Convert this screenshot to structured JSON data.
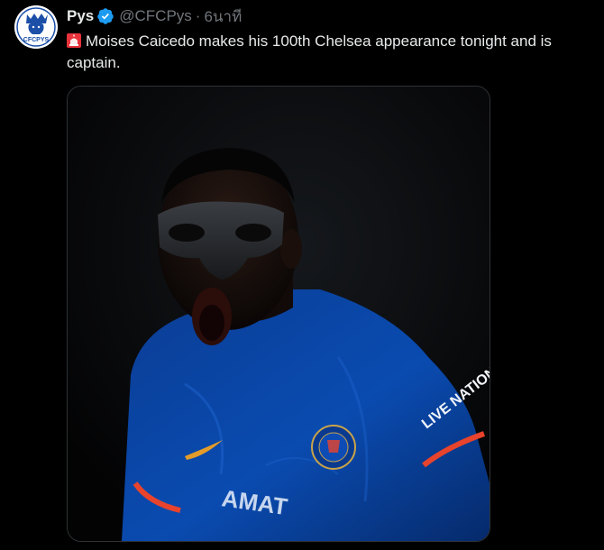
{
  "tweet": {
    "author": {
      "display_name": "Pys",
      "handle": "@CFCPys",
      "verified": true,
      "avatar_text": "CFCPYS"
    },
    "separator": "·",
    "timestamp": "6นาที",
    "emoji_icon": "siren-icon",
    "text": "Moises Caicedo makes his 100th Chelsea appearance tonight and is captain.",
    "media": {
      "shirt_sponsor_left": "AMAT",
      "shirt_sponsor_right": "LIVE NATION"
    }
  },
  "colors": {
    "background": "#000000",
    "text_primary": "#e7e9ea",
    "text_secondary": "#71767b",
    "verified_blue": "#1d9bf0",
    "chelsea_blue": "#0a4bb0"
  }
}
